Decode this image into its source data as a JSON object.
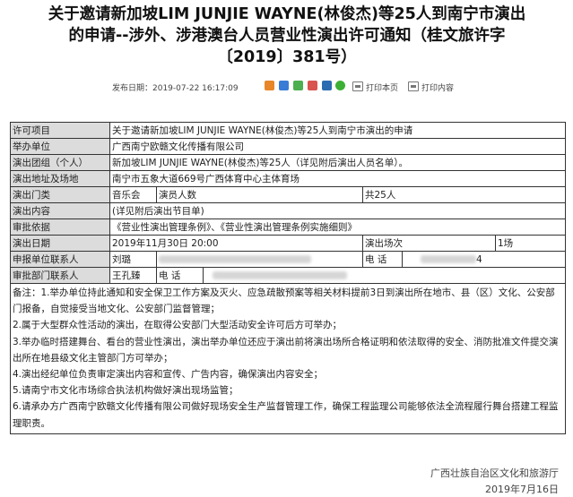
{
  "title": {
    "line1": "关于邀请新加坡LIM JUNJIE WAYNE(林俊杰)等25人到南宁市演出",
    "line2": "的申请--涉外、涉港澳台人员营业性演出许可通知（桂文旅许字",
    "line3": "〔2019〕381号）"
  },
  "meta": {
    "publish_date": "发布日期：2019-07-22 16:17:09",
    "print_page": "打印本页",
    "print_content": "打印内容",
    "share_icons": [
      "share-icon-orange",
      "share-icon-blue",
      "share-icon-green",
      "share-icon-red",
      "share-icon-blue2",
      "share-icon-wechat"
    ]
  },
  "table": {
    "permit_item_label": "许可项目",
    "permit_item_value": "关于邀请新加坡LIM JUNJIE WAYNE(林俊杰)等25人到南宁市演出的申请",
    "organizer_label": "举办单位",
    "organizer_value": "广西南宁欧赣文化传播有限公司",
    "troupe_label": "演出团组（个人）",
    "troupe_value": "新加坡LIM JUNJIE WAYNE(林俊杰)等25人（详见附后演出人员名单）。",
    "venue_label": "演出地址及场地",
    "venue_value": "南宁市五象大道669号广西体育中心主体育场",
    "category_label": "演出门类",
    "category_value": "音乐会",
    "performers_label": "演员人数",
    "performers_value": "共25人",
    "content_label": "演出内容",
    "content_value": "(详见附后演出节目单)",
    "basis_label": "审批依据",
    "basis_value": "《营业性演出管理条例》、《营业性演出管理条例实施细则》",
    "date_label": "演出日期",
    "date_value": "2019年11月30日 20:00",
    "sessions_label": "演出场次",
    "sessions_value": "1场",
    "contact_label": "申报单位联系人",
    "contact_value": "刘璐",
    "phone_label": "电  话",
    "phone_value_tail": "4",
    "dept_contact_label": "审批部门联系人",
    "dept_contact_value": "王孔臻",
    "dept_phone_label": "电 话",
    "notes": [
      "备注：1.举办单位持此通知和安全保卫工作方案及灭火、应急疏散预案等相关材料提前3日到演出所在地市、县（区）文化、公安部门报备，自觉接受当地文化、公安部门监督管理；",
      "2.属于大型群众性活动的演出，在取得公安部门大型活动安全许可后方可举办；",
      "3.举办临时搭建舞台、看台的营业性演出，演出举办单位还应于演出前将演出场所合格证明和依法取得的安全、消防批准文件提交演出所在地县级文化主管部门方可举办；",
      "4.演出经纪单位负责审定演出内容和宣传、广告内容，确保演出内容安全；",
      "5.请南宁市文化市场综合执法机构做好演出现场监管；",
      "6.请承办方广西南宁欧赣文化传播有限公司做好现场安全生产监督管理工作，确保工程监理公司能够依法全流程履行舞台搭建工程监理职责。"
    ]
  },
  "footer": {
    "org": "广西壮族自治区文化和旅游厅",
    "date": "2019年7月16日"
  },
  "colors": {
    "header_cell_bg": "#dcdcdc",
    "border": "#333333"
  }
}
